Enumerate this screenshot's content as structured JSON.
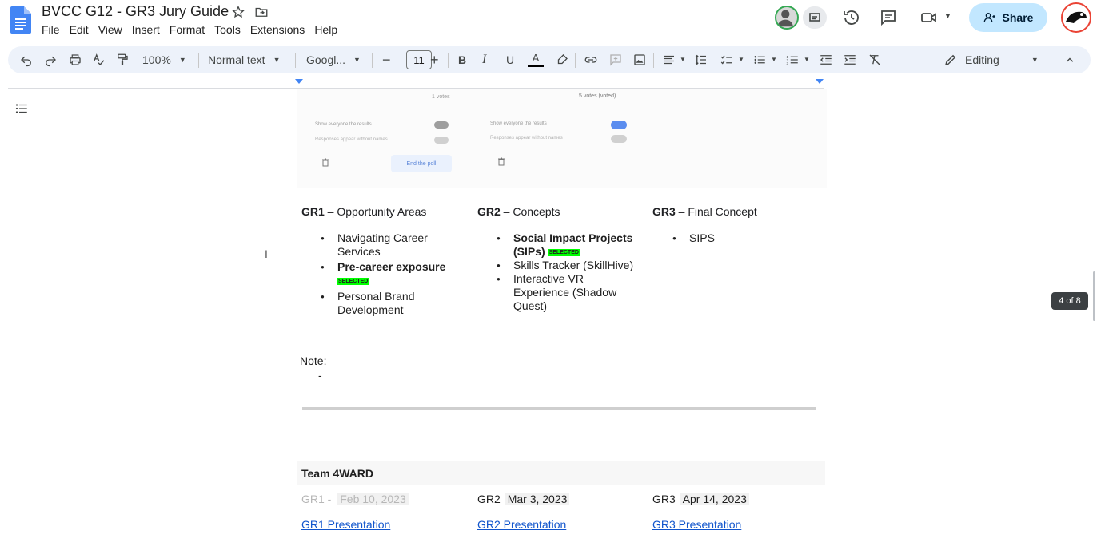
{
  "document": {
    "title": "BVCC G12  - GR3 Jury Guide",
    "menu": [
      "File",
      "Edit",
      "View",
      "Insert",
      "Format",
      "Tools",
      "Extensions",
      "Help"
    ]
  },
  "header": {
    "share_label": "Share"
  },
  "toolbar": {
    "zoom": "100%",
    "style": "Normal text",
    "font": "Googl...",
    "font_size": "11",
    "mode": "Editing"
  },
  "screenshot_fragment": {
    "left_toggle_1": "Show everyone the results",
    "left_toggle_2": "Responses appear without names",
    "end_poll": "End the poll",
    "right_toggle_1": "Show everyone the results",
    "right_toggle_2": "Responses appear without names",
    "top_left": "1 votes",
    "top_right": "5 votes (voted)"
  },
  "table1": {
    "gr1": {
      "label": "GR1",
      "title": " – Opportunity Areas",
      "items": [
        {
          "text": "Navigating Career Services",
          "bold": false,
          "selected": false
        },
        {
          "text": "Pre-career exposure",
          "bold": true,
          "selected": true
        },
        {
          "text": "Personal Brand Development",
          "bold": false,
          "selected": false
        }
      ]
    },
    "gr2": {
      "label": "GR2",
      "title": " – Concepts",
      "items": [
        {
          "text": "Social Impact Projects (SIPs)",
          "bold": true,
          "selected": true
        },
        {
          "text": "Skills Tracker (SkillHive)",
          "bold": false,
          "selected": false
        },
        {
          "text": " Interactive VR Experience (Shadow Quest)",
          "bold": false,
          "selected": false
        }
      ]
    },
    "gr3": {
      "label": "GR3",
      "title": " – Final Concept",
      "items": [
        {
          "text": "SIPS",
          "bold": false,
          "selected": false
        }
      ]
    },
    "selected_tag": "SELECTED"
  },
  "note": {
    "label": "Note:",
    "dash": "-"
  },
  "team": {
    "name": "Team 4WARD",
    "gr1_label": "GR1 -",
    "gr1_date": "Feb 10, 2023",
    "gr2_label": "GR2",
    "gr2_date": "Mar 3, 2023",
    "gr3_label": "GR3",
    "gr3_date": "Apr 14, 2023",
    "gr1_link": "GR1 Presentation",
    "gr2_link": "GR2 Presentation",
    "gr3_link": "GR3 Presentation"
  },
  "page_indicator": "4 of 8",
  "colors": {
    "accent": "#c2e7ff",
    "toolbar_bg": "#edf2fa",
    "selected_highlight": "#00ff00",
    "link": "#1155cc"
  }
}
